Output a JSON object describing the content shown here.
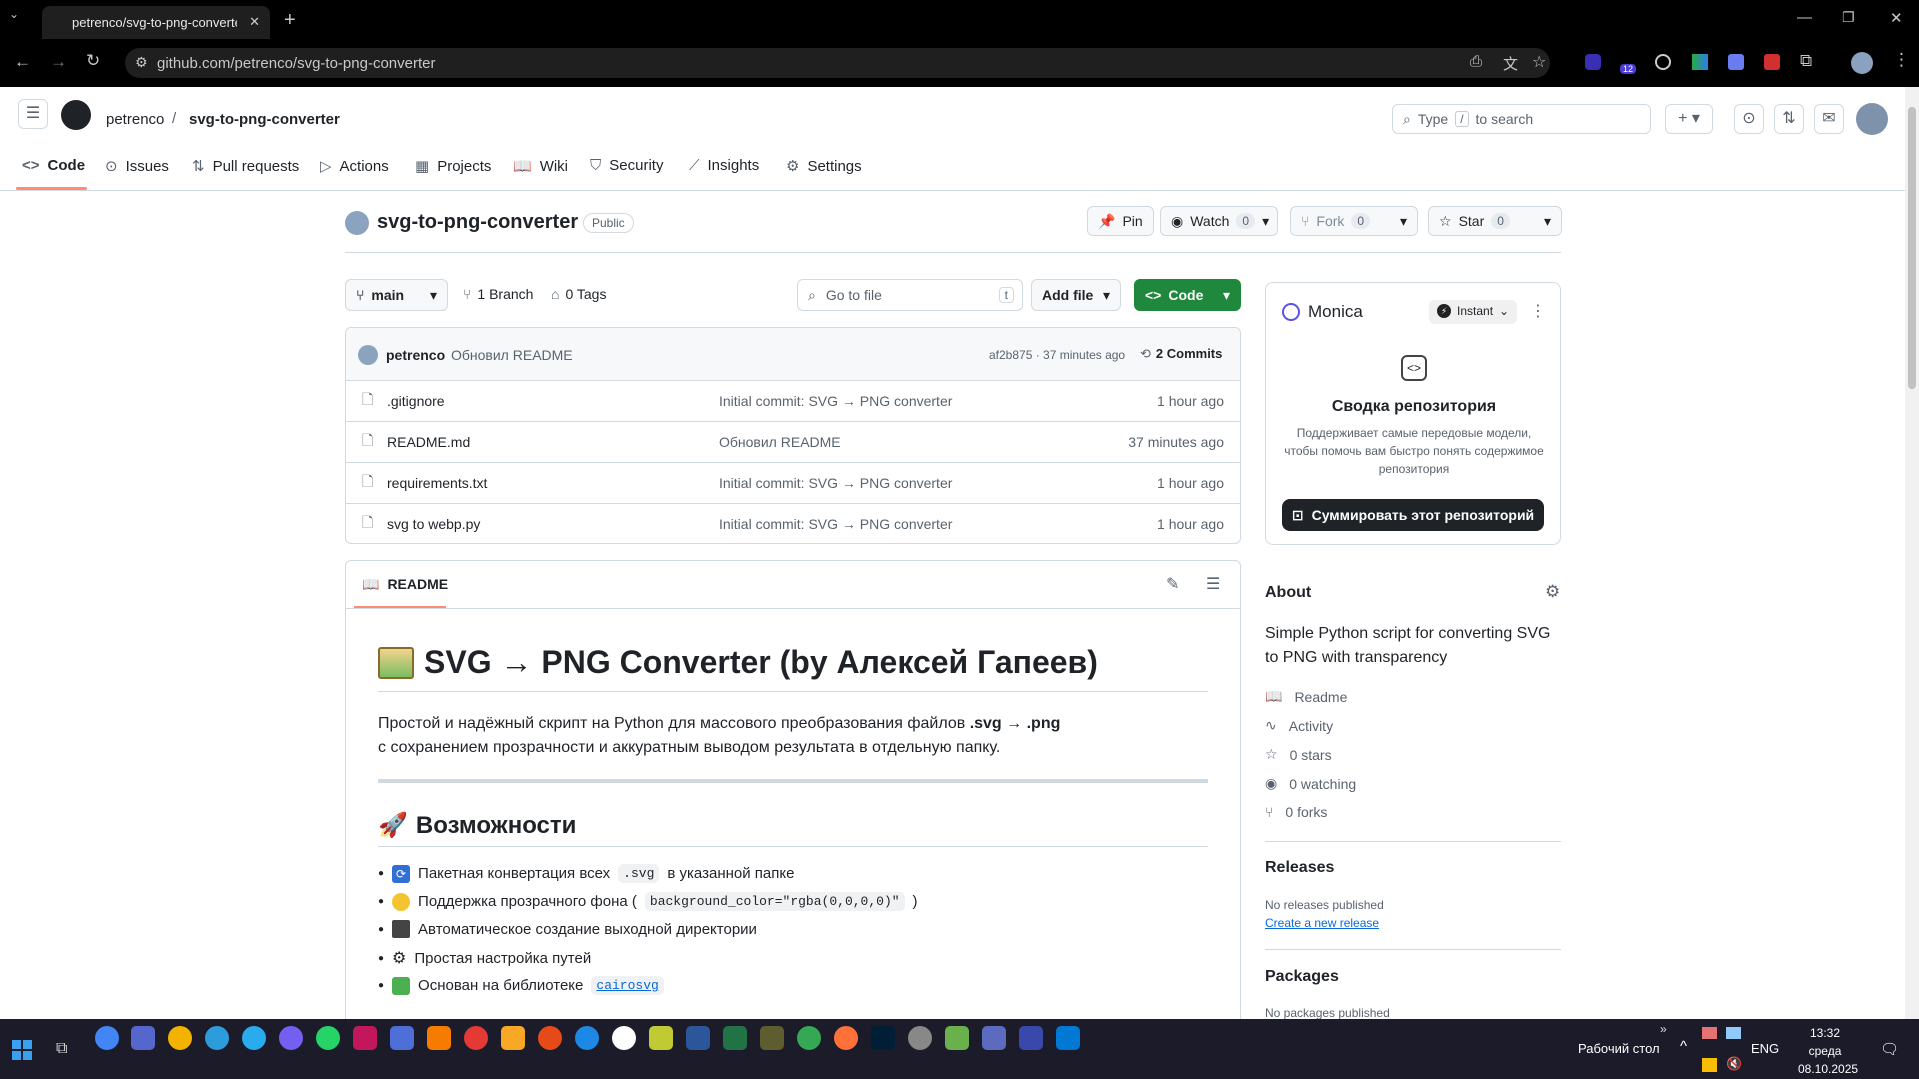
{
  "browser": {
    "tab_title": "petrenco/svg-to-png-converter",
    "url": "github.com/petrenco/svg-to-png-converter",
    "extension_badge": "12"
  },
  "github": {
    "owner": "petrenco",
    "repo": "svg-to-png-converter",
    "search_placeholder": "Type / to search",
    "search_prefix": "Type",
    "search_key": "/",
    "search_suffix": "to search",
    "nav": [
      "Code",
      "Issues",
      "Pull requests",
      "Actions",
      "Projects",
      "Wiki",
      "Security",
      "Insights",
      "Settings"
    ],
    "visibility": "Public",
    "pin": "Pin",
    "watch": "Watch",
    "watch_count": "0",
    "fork": "Fork",
    "fork_count": "0",
    "star": "Star",
    "star_count": "0",
    "branch": "main",
    "branches": "1 Branch",
    "tags": "0 Tags",
    "go_to_file": "Go to file",
    "go_to_file_key": "t",
    "add_file": "Add file",
    "code_btn": "Code",
    "commit": {
      "author": "petrenco",
      "message": "Обновил README",
      "hash": "af2b875 · 37 minutes ago",
      "commits": "2 Commits"
    },
    "files": [
      {
        "name": ".gitignore",
        "msg": "Initial commit: SVG → PNG converter",
        "time": "1 hour ago"
      },
      {
        "name": "README.md",
        "msg": "Обновил README",
        "time": "37 minutes ago"
      },
      {
        "name": "requirements.txt",
        "msg": "Initial commit: SVG → PNG converter",
        "time": "1 hour ago"
      },
      {
        "name": "svg to webp.py",
        "msg": "Initial commit: SVG → PNG converter",
        "time": "1 hour ago"
      }
    ],
    "readme": {
      "tab": "README",
      "title": "SVG → PNG Converter (by Алексей Гапеев)",
      "intro1": "Простой и надёжный скрипт на Python для массового преобразования файлов",
      "intro1b": ".svg → .png",
      "intro2": "с сохранением прозрачности и аккуратным выводом результата в отдельную папку.",
      "h2": "Возможности",
      "features": [
        {
          "pre": "Пакетная конвертация всех",
          "code": ".svg",
          "post": "в указанной папке"
        },
        {
          "pre": "Поддержка прозрачного фона (",
          "code": "background_color=\"rgba(0,0,0,0)\"",
          "post": ")"
        },
        {
          "pre": "Автоматическое создание выходной директории",
          "code": "",
          "post": ""
        },
        {
          "pre": "Простая настройка путей",
          "code": "",
          "post": ""
        },
        {
          "pre": "Основан на библиотеке",
          "code": "cairosvg",
          "post": ""
        }
      ]
    },
    "monica": {
      "name": "Monica",
      "mode": "Instant",
      "heading": "Сводка репозитория",
      "desc": "Поддерживает самые передовые модели, чтобы помочь вам быстро понять содержимое репозитория",
      "button": "Суммировать этот репозиторий"
    },
    "about": {
      "title": "About",
      "desc": "Simple Python script for converting SVG to PNG with transparency",
      "items": [
        "Readme",
        "Activity",
        "0 stars",
        "0 watching",
        "0 forks"
      ]
    },
    "releases": {
      "title": "Releases",
      "none": "No releases published",
      "link": "Create a new release"
    },
    "packages": {
      "title": "Packages",
      "none": "No packages published"
    }
  },
  "taskbar": {
    "desktop": "Рабочий стол",
    "lang": "ENG",
    "time": "13:32",
    "day": "среда",
    "date": "08.10.2025"
  }
}
